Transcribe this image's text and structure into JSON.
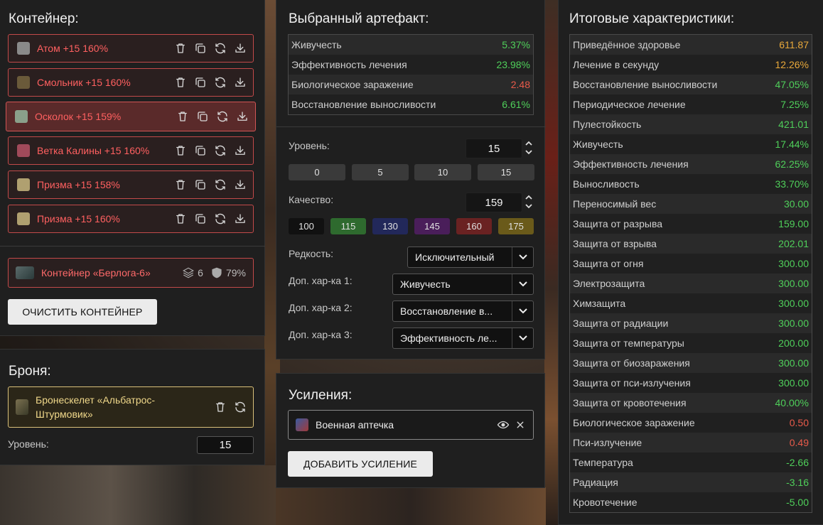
{
  "container": {
    "title": "Контейнер:",
    "artifacts": [
      {
        "name": "Атом +15 160%",
        "thumb_color": "#8a8a8a"
      },
      {
        "name": "Смольник +15 160%",
        "thumb_color": "#6a5a3a"
      },
      {
        "name": "Осколок +15 159%",
        "thumb_color": "#8aa08a"
      },
      {
        "name": "Ветка Калины +15 160%",
        "thumb_color": "#a04a5a"
      },
      {
        "name": "Призма +15 158%",
        "thumb_color": "#b0a070"
      },
      {
        "name": "Призма +15 160%",
        "thumb_color": "#b0a070"
      }
    ],
    "container_item": {
      "name": "Контейнер «Берлога-6»",
      "slots": "6",
      "protection": "79%"
    },
    "clear_button": "ОЧИСТИТЬ КОНТЕЙНЕР"
  },
  "armor": {
    "title": "Броня:",
    "name_line1": "Бронескелет «Альбатрос-",
    "name_line2": "Штурмовик»",
    "level_label": "Уровень:",
    "level_value": "15"
  },
  "selected_artifact": {
    "title": "Выбранный артефакт:",
    "stats": [
      {
        "name": "Живучесть",
        "value": "5.37%",
        "color": "green"
      },
      {
        "name": "Эффективность лечения",
        "value": "23.98%",
        "color": "green"
      },
      {
        "name": "Биологическое заражение",
        "value": "2.48",
        "color": "red"
      },
      {
        "name": "Восстановление выносливости",
        "value": "6.61%",
        "color": "green"
      }
    ],
    "level_label": "Уровень:",
    "level_value": "15",
    "level_presets": [
      "0",
      "5",
      "10",
      "15"
    ],
    "quality_label": "Качество:",
    "quality_value": "159",
    "quality_presets": [
      {
        "label": "100",
        "color": "#111111"
      },
      {
        "label": "115",
        "color": "#2e6a2e"
      },
      {
        "label": "130",
        "color": "#22285a"
      },
      {
        "label": "145",
        "color": "#4a1e5a"
      },
      {
        "label": "160",
        "color": "#6a2222"
      },
      {
        "label": "175",
        "color": "#6a5a1a"
      }
    ],
    "rarity_label": "Редкость:",
    "rarity_value": "Исключительный",
    "extra1_label": "Доп. хар-ка 1:",
    "extra1_value": "Живучесть",
    "extra2_label": "Доп. хар-ка 2:",
    "extra2_value": "Восстановление в...",
    "extra3_label": "Доп. хар-ка 3:",
    "extra3_value": "Эффективность ле..."
  },
  "boosts": {
    "title": "Усиления:",
    "item": "Военная аптечка",
    "add_button": "ДОБАВИТЬ УСИЛЕНИЕ"
  },
  "totals": {
    "title": "Итоговые характеристики:",
    "stats": [
      {
        "name": "Приведённое здоровье",
        "value": "611.87",
        "color": "orange"
      },
      {
        "name": "Лечение в секунду",
        "value": "12.26%",
        "color": "orange"
      },
      {
        "name": "Восстановление выносливости",
        "value": "47.05%",
        "color": "green"
      },
      {
        "name": "Периодическое лечение",
        "value": "7.25%",
        "color": "green"
      },
      {
        "name": "Пулестойкость",
        "value": "421.01",
        "color": "green"
      },
      {
        "name": "Живучесть",
        "value": "17.44%",
        "color": "green"
      },
      {
        "name": "Эффективность лечения",
        "value": "62.25%",
        "color": "green"
      },
      {
        "name": "Выносливость",
        "value": "33.70%",
        "color": "green"
      },
      {
        "name": "Переносимый вес",
        "value": "30.00",
        "color": "green"
      },
      {
        "name": "Защита от разрыва",
        "value": "159.00",
        "color": "green"
      },
      {
        "name": "Защита от взрыва",
        "value": "202.01",
        "color": "green"
      },
      {
        "name": "Защита от огня",
        "value": "300.00",
        "color": "green"
      },
      {
        "name": "Электрозащита",
        "value": "300.00",
        "color": "green"
      },
      {
        "name": "Химзащита",
        "value": "300.00",
        "color": "green"
      },
      {
        "name": "Защита от радиации",
        "value": "300.00",
        "color": "green"
      },
      {
        "name": "Защита от температуры",
        "value": "200.00",
        "color": "green"
      },
      {
        "name": "Защита от биозаражения",
        "value": "300.00",
        "color": "green"
      },
      {
        "name": "Защита от пси-излучения",
        "value": "300.00",
        "color": "green"
      },
      {
        "name": "Защита от кровотечения",
        "value": "40.00%",
        "color": "green"
      },
      {
        "name": "Биологическое заражение",
        "value": "0.50",
        "color": "red"
      },
      {
        "name": "Пси-излучение",
        "value": "0.49",
        "color": "red"
      },
      {
        "name": "Температура",
        "value": "-2.66",
        "color": "green"
      },
      {
        "name": "Радиация",
        "value": "-3.16",
        "color": "green"
      },
      {
        "name": "Кровотечение",
        "value": "-5.00",
        "color": "green"
      }
    ]
  }
}
